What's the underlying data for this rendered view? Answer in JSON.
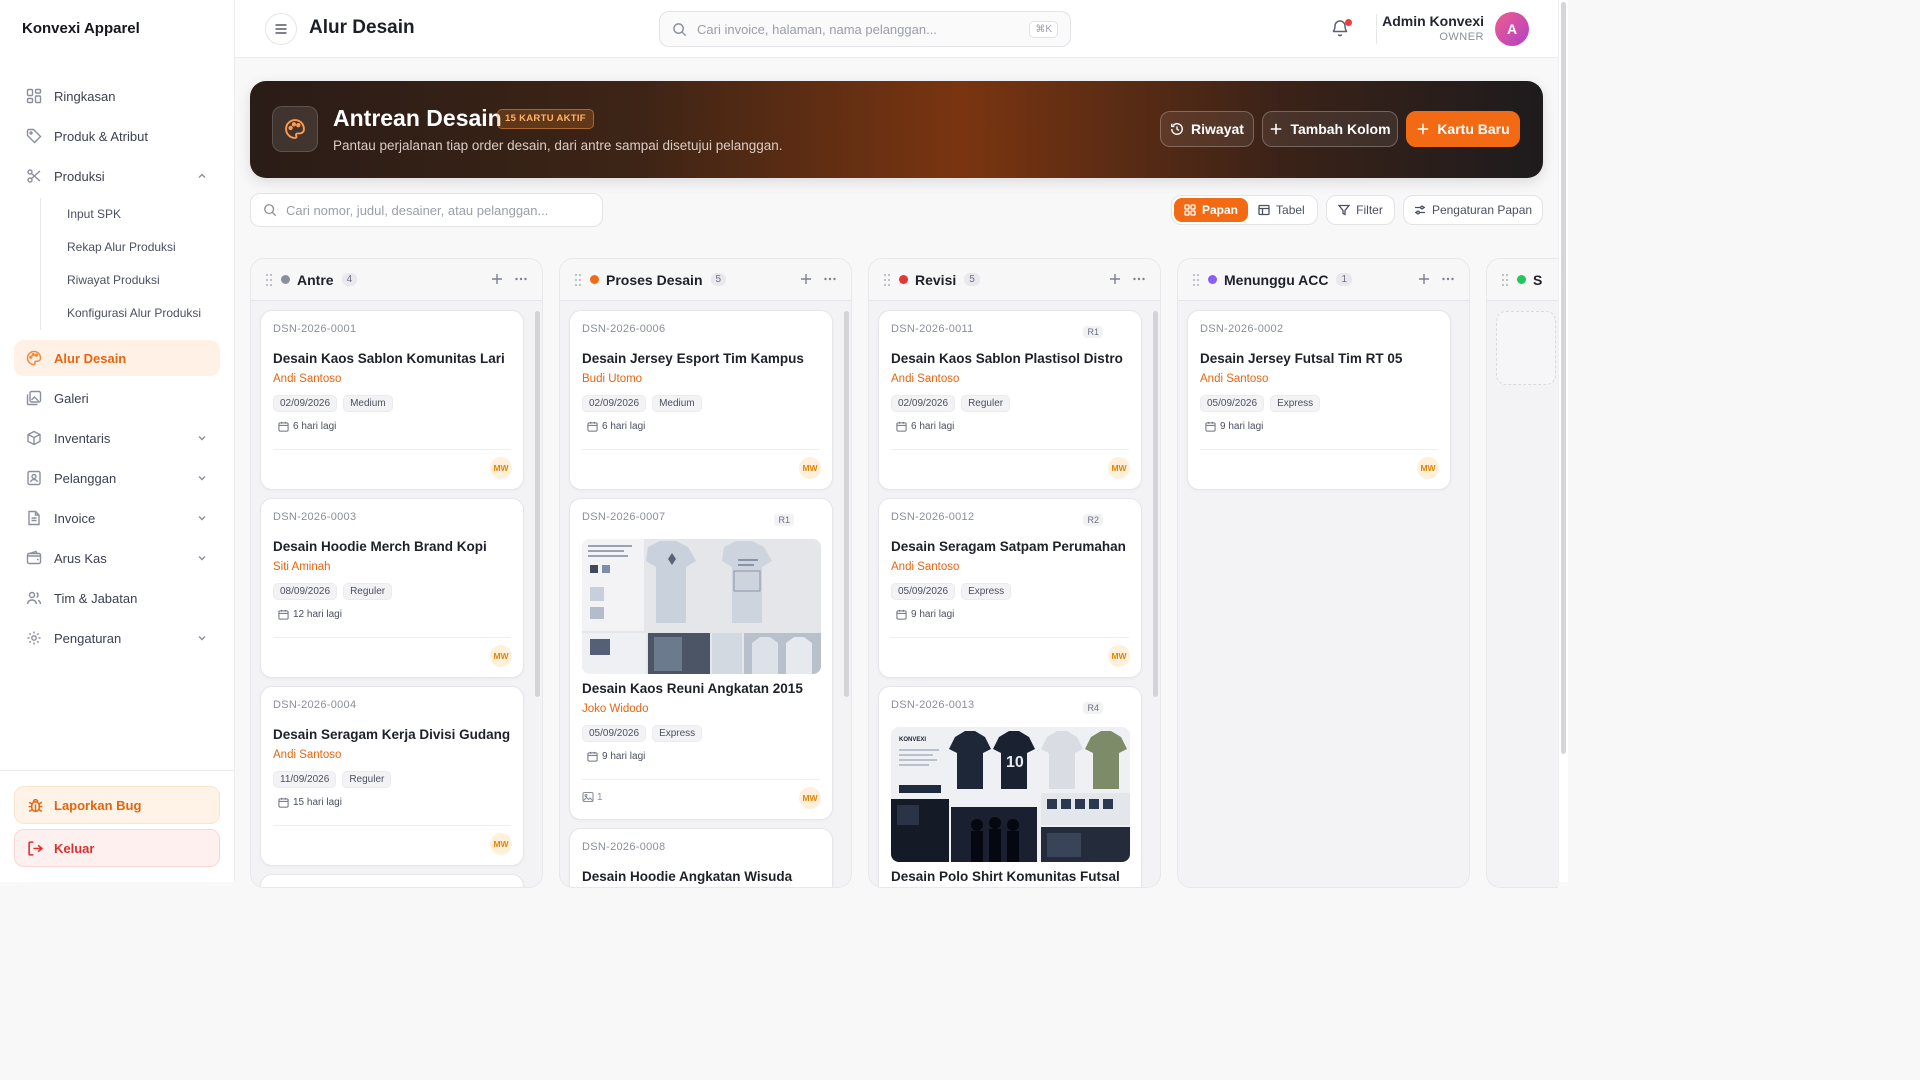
{
  "brand": "Konvexi Apparel",
  "sidebar": {
    "items": [
      {
        "label": "Ringkasan"
      },
      {
        "label": "Produk & Atribut"
      },
      {
        "label": "Produksi"
      },
      {
        "label": "Alur Desain"
      },
      {
        "label": "Galeri"
      },
      {
        "label": "Inventaris"
      },
      {
        "label": "Pelanggan"
      },
      {
        "label": "Invoice"
      },
      {
        "label": "Arus Kas"
      },
      {
        "label": "Tim & Jabatan"
      },
      {
        "label": "Pengaturan"
      }
    ],
    "produksi_sub": [
      "Input SPK",
      "Rekap Alur Produksi",
      "Riwayat Produksi",
      "Konfigurasi Alur Produksi"
    ],
    "report_bug": "Laporkan Bug",
    "logout": "Keluar"
  },
  "header": {
    "title": "Alur Desain",
    "search_placeholder": "Cari invoice, halaman, nama pelanggan...",
    "shortcut": "⌘K",
    "user_name": "Admin Konvexi",
    "user_role": "OWNER",
    "avatar_initial": "A"
  },
  "hero": {
    "title": "Antrean Desain",
    "badge": "15 KARTU AKTIF",
    "subtitle": "Pantau perjalanan tiap order desain, dari antre sampai disetujui pelanggan.",
    "btn_history": "Riwayat",
    "btn_add_column": "Tambah Kolom",
    "btn_new_card": "Kartu Baru"
  },
  "toolbar": {
    "search_placeholder": "Cari nomor, judul, desainer, atau pelanggan...",
    "view_board": "Papan",
    "view_table": "Tabel",
    "filter": "Filter",
    "board_settings": "Pengaturan Papan"
  },
  "columns": [
    {
      "title": "Antre",
      "count": "4",
      "color": "#8a8f9c",
      "cards": [
        {
          "code": "DSN-2026-0001",
          "title": "Desain Kaos Sablon Komunitas Lari",
          "customer": "Andi Santoso",
          "date": "02/09/2026",
          "tag": "Medium",
          "due": "6 hari lagi",
          "assignee": "MW"
        },
        {
          "code": "DSN-2026-0003",
          "title": "Desain Hoodie Merch Brand Kopi",
          "customer": "Siti Aminah",
          "date": "08/09/2026",
          "tag": "Reguler",
          "due": "12 hari lagi",
          "assignee": "MW"
        },
        {
          "code": "DSN-2026-0004",
          "title": "Desain Seragam Kerja Divisi Gudang",
          "customer": "Andi Santoso",
          "date": "11/09/2026",
          "tag": "Reguler",
          "due": "15 hari lagi",
          "assignee": "MW"
        }
      ]
    },
    {
      "title": "Proses Desain",
      "count": "5",
      "color": "#f26a14",
      "cards": [
        {
          "code": "DSN-2026-0006",
          "title": "Desain Jersey Esport Tim Kampus",
          "customer": "Budi Utomo",
          "date": "02/09/2026",
          "tag": "Medium",
          "due": "6 hari lagi",
          "assignee": "MW"
        },
        {
          "code": "DSN-2026-0007",
          "revision": "R1",
          "title": "Desain Kaos Reuni Angkatan 2015",
          "customer": "Joko Widodo",
          "date": "05/09/2026",
          "tag": "Express",
          "due": "9 hari lagi",
          "attachments": "1",
          "assignee": "MW"
        },
        {
          "code": "DSN-2026-0008",
          "title": "Desain Hoodie Angkatan Wisuda"
        }
      ]
    },
    {
      "title": "Revisi",
      "count": "5",
      "color": "#e63535",
      "cards": [
        {
          "code": "DSN-2026-0011",
          "revision": "R1",
          "title": "Desain Kaos Sablon Plastisol Distro",
          "customer": "Andi Santoso",
          "date": "02/09/2026",
          "tag": "Reguler",
          "due": "6 hari lagi",
          "assignee": "MW"
        },
        {
          "code": "DSN-2026-0012",
          "revision": "R2",
          "title": "Desain Seragam Satpam Perumahan",
          "customer": "Andi Santoso",
          "date": "05/09/2026",
          "tag": "Express",
          "due": "9 hari lagi",
          "assignee": "MW"
        },
        {
          "code": "DSN-2026-0013",
          "revision": "R4",
          "title": "Desain Polo Shirt Komunitas Futsal",
          "image_brand": "KONVEXI",
          "image_number": "10"
        }
      ]
    },
    {
      "title": "Menunggu ACC",
      "count": "1",
      "color": "#8b5cf6",
      "cards": [
        {
          "code": "DSN-2026-0002",
          "title": "Desain Jersey Futsal Tim RT 05",
          "customer": "Andi Santoso",
          "date": "05/09/2026",
          "tag": "Express",
          "due": "9 hari lagi",
          "assignee": "MW"
        }
      ]
    },
    {
      "title": "S",
      "color": "#22c55e"
    }
  ],
  "colors": {
    "accent": "#f26a14",
    "active_bg": "#fff1e6"
  }
}
